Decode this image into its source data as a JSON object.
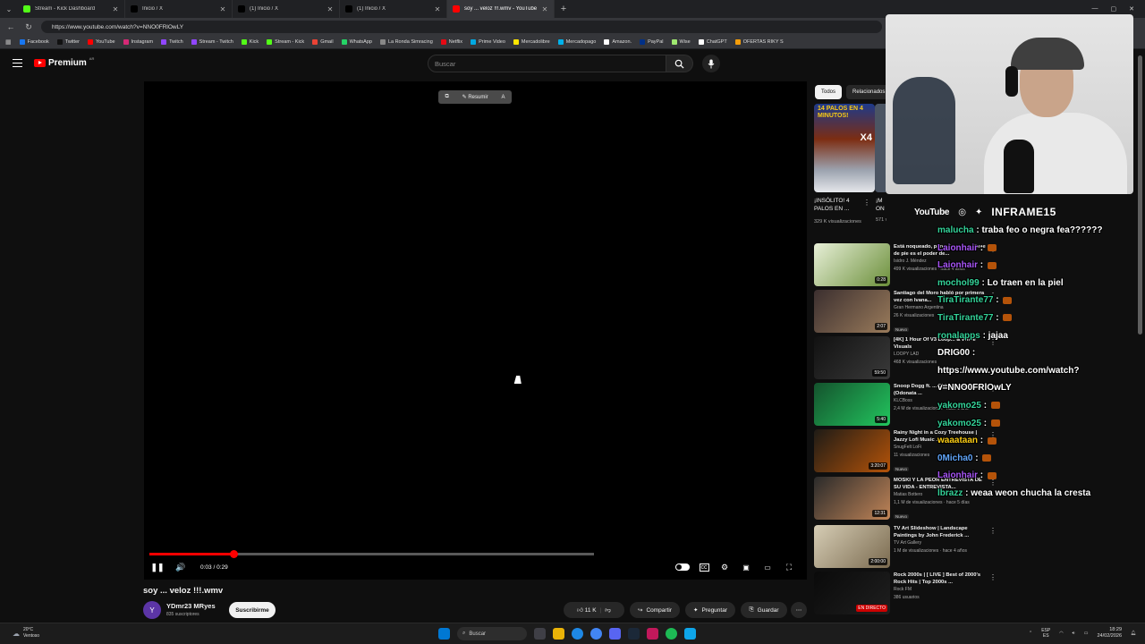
{
  "browser": {
    "tabs": [
      {
        "title": "Stream - Kick Dashboard",
        "color": "#53fc18",
        "active": false
      },
      {
        "title": "Inicio / X",
        "color": "#000000",
        "active": false
      },
      {
        "title": "(1) Inicio / X",
        "color": "#000000",
        "active": false
      },
      {
        "title": "(1) Inicio / X",
        "color": "#000000",
        "active": false
      },
      {
        "title": "soy ... veloz !!!.wmv - YouTube",
        "color": "#ff0000",
        "active": true
      }
    ],
    "url": "https://www.youtube.com/watch?v=NNO0FRlOwLY",
    "bookmarks": [
      {
        "label": "Facebook",
        "color": "#1877f2"
      },
      {
        "label": "Twitter",
        "color": "#111111"
      },
      {
        "label": "YouTube",
        "color": "#ff0000"
      },
      {
        "label": "Instagram",
        "color": "#d62976"
      },
      {
        "label": "Twitch",
        "color": "#9146ff"
      },
      {
        "label": "Stream - Twitch",
        "color": "#9146ff"
      },
      {
        "label": "Kick",
        "color": "#53fc18"
      },
      {
        "label": "Stream - Kick",
        "color": "#53fc18"
      },
      {
        "label": "Gmail",
        "color": "#ea4335"
      },
      {
        "label": "WhatsApp",
        "color": "#25d366"
      },
      {
        "label": "La Ronda Simracing",
        "color": "#888888"
      },
      {
        "label": "Netflix",
        "color": "#e50914"
      },
      {
        "label": "Prime Video",
        "color": "#00a8e1"
      },
      {
        "label": "Mercadolibre",
        "color": "#ffe600"
      },
      {
        "label": "Mercadopago",
        "color": "#00b1ea"
      },
      {
        "label": "Amazon.",
        "color": "#ffffff"
      },
      {
        "label": "PayPal",
        "color": "#003087"
      },
      {
        "label": "Wise",
        "color": "#9fe870"
      },
      {
        "label": "ChatGPT",
        "color": "#ffffff"
      },
      {
        "label": "OFERTAS RIKY S",
        "color": "#f59e0b"
      }
    ]
  },
  "header": {
    "logo_text": "Premium",
    "logo_cc": "AR",
    "search_placeholder": "Buscar"
  },
  "player": {
    "summarize_label": "Resumir",
    "time": "0:03 / 0:29",
    "progress_fraction": 0.19,
    "buffered_fraction": 1.0
  },
  "video": {
    "title": "soy ... veloz !!!.wmv",
    "channel": "YDmr23 MRyes",
    "channel_initial": "Y",
    "subscribers": "835 suscriptores",
    "subscribe_label": "Suscribirme",
    "likes": "11 K",
    "share_label": "Compartir",
    "ask_label": "Preguntar",
    "save_label": "Guardar"
  },
  "sidebar": {
    "chips": [
      {
        "label": "Todos",
        "active": true
      },
      {
        "label": "Relacionados",
        "active": false
      }
    ],
    "short": {
      "overlay_top": "14 PALOS EN 4 MINUTOS!",
      "overlay_x": "X4",
      "title": "¡INSÓLITO! 4 PALOS EN ...",
      "views": "329 K visualizaciones"
    },
    "short2": {
      "title": "¡M ON",
      "views": "571 visualizaciones"
    },
    "recommendations": [
      {
        "title": "Está noqueado, pero sigue, mantiene de pie es el poder de...",
        "channel": "Isidro J. Méndez",
        "meta": "499 K visualizaciones · hace 4 años",
        "duration": "0:28",
        "badge": "",
        "color1": "#e8f0d8",
        "color2": "#6b8f3a"
      },
      {
        "title": "Santiago del Moro habló por primera vez con Ivana...",
        "channel": "Gran Hermano Argentina",
        "meta": "26 K visualizaciones",
        "duration": "2:07",
        "badge": "Nuevo",
        "color1": "#3b2f2f",
        "color2": "#9a7b5b"
      },
      {
        "title": "[4K] 1 Hour Of V3 Loop... & White Visuals",
        "channel": "LOOPY LAD",
        "meta": "468 K visualizaciones",
        "duration": "59:50",
        "badge": "",
        "color1": "#111111",
        "color2": "#3a3a3a"
      },
      {
        "title": "Snoop Dogg ft. ... Riders on the Storm (Odonata ...",
        "channel": "KLCBoss",
        "meta": "2,4 M de visualizaciones · hace 1 año",
        "duration": "5:40",
        "badge": "",
        "color1": "#14532d",
        "color2": "#22c55e"
      },
      {
        "title": "Rainy Night in a Cozy Treehouse | Jazzy Lofi Music ...",
        "channel": "SnugFelt LoFi",
        "meta": "11 visualizaciones",
        "duration": "3:20:07",
        "badge": "Nuevo",
        "color1": "#1e1b16",
        "color2": "#b45309"
      },
      {
        "title": "MOSKI Y LA PEOR ENTREVISTA DE SU VIDA - ENTREVISTA...",
        "channel": "Matias Bottero",
        "meta": "1,1 M de visualizaciones · hace 5 días",
        "duration": "12:31",
        "badge": "Nuevo",
        "color1": "#2a2a2a",
        "color2": "#c08457"
      },
      {
        "title": "TV Art Slideshow | Landscape Paintings by John Frederick ...",
        "channel": "TV Art Gallery",
        "meta": "1 M de visualizaciones · hace 4 años",
        "duration": "2:00:00",
        "badge": "",
        "color1": "#d6cdb5",
        "color2": "#7a6a4f"
      },
      {
        "title": "Rock 2000s | [ LIVE ] Best of 2000's Rock Hits | Top 2000s ...",
        "channel": "Rock FM",
        "meta": "386 usuarios",
        "duration": "EN DIRECTO",
        "badge": "",
        "color1": "#0a0a0a",
        "color2": "#1f1f1f"
      }
    ]
  },
  "overlay": {
    "brand_yt": "YouTube",
    "brand_name": "INFRAME15",
    "chat": [
      {
        "user": "malucha",
        "msg": " : traba feo o negra fea??????",
        "color": "#34d399",
        "emote": false
      },
      {
        "user": "Laionhair",
        "msg": " : ",
        "color": "#a855f7",
        "emote": true
      },
      {
        "user": "Laionhair",
        "msg": " : ",
        "color": "#a855f7",
        "emote": true
      },
      {
        "user": "mochol99",
        "msg": " : Lo traen en la piel",
        "color": "#34d399",
        "emote": false
      },
      {
        "user": "TiraTirante77",
        "msg": " : ",
        "color": "#34d399",
        "emote": true
      },
      {
        "user": "TiraTirante77",
        "msg": " : ",
        "color": "#34d399",
        "emote": true
      },
      {
        "user": "ronalapps",
        "msg": " : jajaa",
        "color": "#34d399",
        "emote": false
      },
      {
        "user": "DRIG00",
        "msg": " :",
        "color": "#ffffff",
        "emote": false
      },
      {
        "user": "",
        "msg": "https://www.youtube.com/watch?",
        "color": "#ffffff",
        "emote": false
      },
      {
        "user": "",
        "msg": "v=NNO0FRlOwLY",
        "color": "#ffffff",
        "emote": false
      },
      {
        "user": "yakomo25",
        "msg": " : ",
        "color": "#34d399",
        "emote": true
      },
      {
        "user": "yakomo25",
        "msg": " : ",
        "color": "#34d399",
        "emote": true
      },
      {
        "user": "waaataan",
        "msg": " : ",
        "color": "#facc15",
        "emote": true
      },
      {
        "user": "0Micha0",
        "msg": " : ",
        "color": "#60a5fa",
        "emote": true
      },
      {
        "user": "Laionhair",
        "msg": " : ",
        "color": "#a855f7",
        "emote": true
      },
      {
        "user": "lbrazz",
        "msg": " : weaa weon chucha la cresta",
        "color": "#34d399",
        "emote": false
      }
    ]
  },
  "taskbar": {
    "temperature": "20°C",
    "condition": "Ventoso",
    "search_label": "Buscar",
    "lang": "ESP",
    "lang2": "ES",
    "time": "18:29",
    "date": "24/02/2026"
  }
}
